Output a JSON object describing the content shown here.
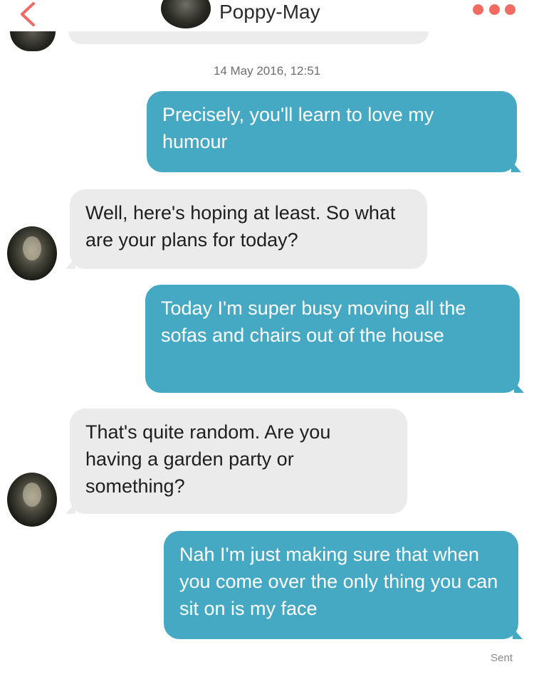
{
  "header": {
    "back_icon": "chevron-left-icon",
    "contact_name": "Poppy-May",
    "more_icon": "more-dots-icon",
    "accent_color": "#f26b62"
  },
  "conversation": {
    "timestamp": "14 May 2016, 12:51",
    "messages": [
      {
        "direction": "sent",
        "text": "Precisely, you'll learn to love my humour"
      },
      {
        "direction": "received",
        "text": "Well, here's hoping at least. So what are your plans for today?"
      },
      {
        "direction": "sent",
        "text": "Today I'm super busy moving all the sofas and chairs out of the house"
      },
      {
        "direction": "received",
        "text": "That's quite random. Are you having a garden party or something?"
      },
      {
        "direction": "sent",
        "text": "Nah I'm just making sure that when you come over the only thing you can sit on is my face"
      }
    ],
    "delivery_status": "Sent"
  },
  "colors": {
    "sent_bubble": "#46a9c4",
    "received_bubble": "#ebebeb"
  }
}
